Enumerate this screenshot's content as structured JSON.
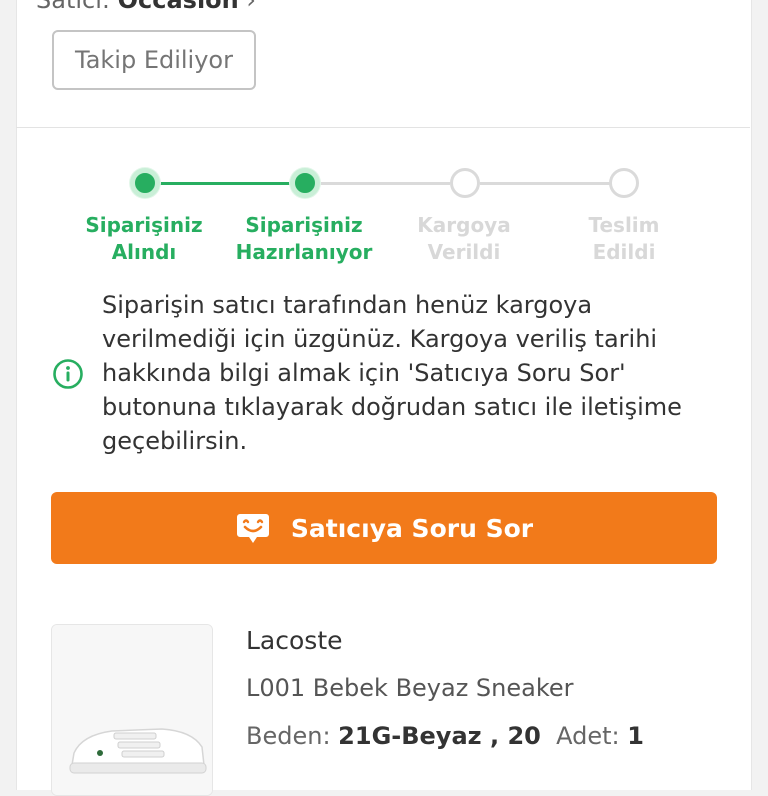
{
  "seller": {
    "prefix": "Satıcı: ",
    "name": "Occasion",
    "chevron": "›",
    "follow_label": "Takip Ediliyor"
  },
  "stepper": {
    "steps": [
      {
        "label": "Siparişiniz\nAlındı",
        "state": "done"
      },
      {
        "label": "Siparişiniz\nHazırlanıyor",
        "state": "done"
      },
      {
        "label": "Kargoya\nVerildi",
        "state": "pending"
      },
      {
        "label": "Teslim\nEdildi",
        "state": "pending"
      }
    ]
  },
  "info": {
    "icon": "info-icon",
    "text": "Siparişin satıcı tarafından henüz kargoya verilmediği için üzgünüz. Kargoya veriliş tarihi hakkında bilgi almak için 'Satıcıya Soru Sor' butonuna tıklayarak doğrudan satıcı ile iletişime geçebilirsin."
  },
  "ask_button": {
    "label": "Satıcıya Soru Sor",
    "icon": "chat-bubble-icon"
  },
  "product": {
    "brand": "Lacoste",
    "name": "L001 Bebek Beyaz Sneaker",
    "size_label": "Beden:",
    "size_value": "21G-Beyaz , 20",
    "qty_label": "Adet:",
    "qty_value": "1"
  },
  "colors": {
    "green": "#27ae60",
    "orange": "#f27a1a",
    "pending": "#dadada"
  }
}
